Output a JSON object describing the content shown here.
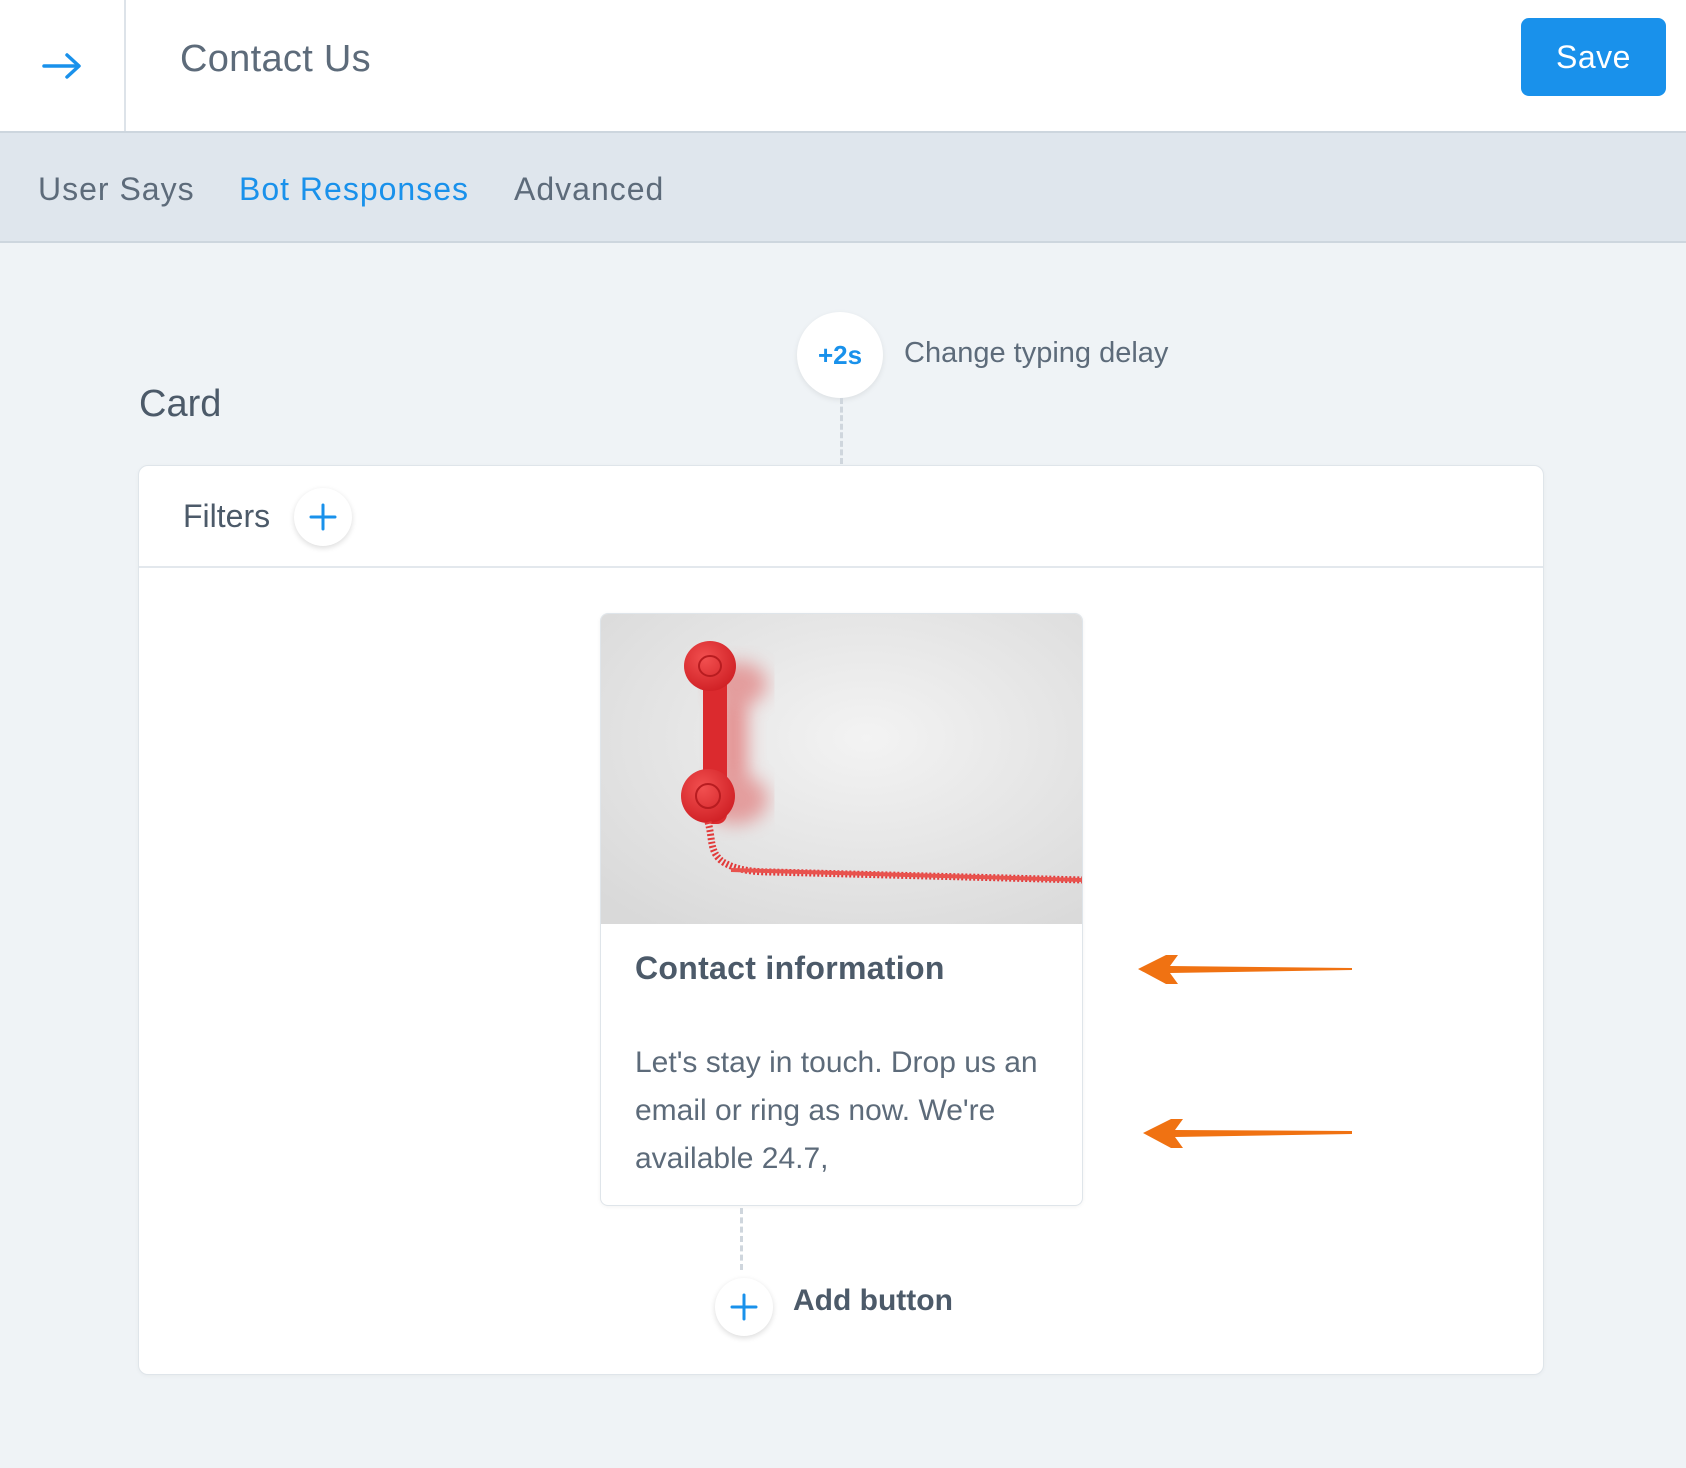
{
  "header": {
    "back_icon": "arrow-right-icon",
    "title": "Contact Us",
    "save_label": "Save"
  },
  "tabs": [
    {
      "label": "User Says",
      "active": false
    },
    {
      "label": "Bot Responses",
      "active": true
    },
    {
      "label": "Advanced",
      "active": false
    }
  ],
  "typing_delay": {
    "value": "+2s",
    "label": "Change typing delay"
  },
  "section": {
    "label": "Card"
  },
  "filters": {
    "label": "Filters",
    "add_icon": "plus-icon"
  },
  "card": {
    "image_icon": "red-telephone-image",
    "title": "Contact information",
    "body": "Let's stay in touch. Drop us an email or ring as now. We're available 24.7,"
  },
  "add_button": {
    "label": "Add button",
    "add_icon": "plus-icon"
  },
  "colors": {
    "accent": "#1991eb",
    "annotation_arrow": "#f07212",
    "background": "#eff3f6",
    "tab_bar": "#dfe6ed"
  }
}
